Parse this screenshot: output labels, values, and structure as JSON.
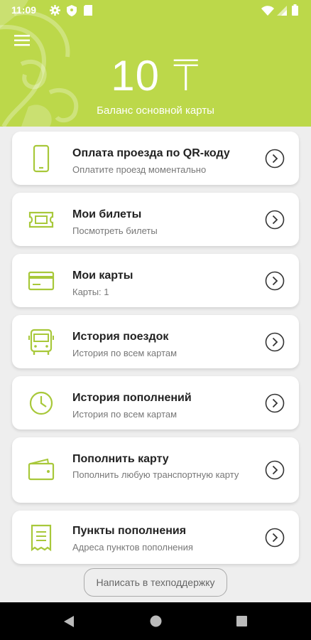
{
  "status_bar": {
    "time": "11:09"
  },
  "header": {
    "balance": "10 ₸",
    "balance_caption": "Баланс основной карты"
  },
  "menu_items": [
    {
      "title": "Оплата проезда по QR-коду",
      "subtitle": "Оплатите проезд моментально",
      "icon": "phone-icon"
    },
    {
      "title": "Мои билеты",
      "subtitle": "Посмотреть билеты",
      "icon": "ticket-icon"
    },
    {
      "title": "Мои карты",
      "subtitle": "Карты: 1",
      "icon": "card-icon"
    },
    {
      "title": "История поездок",
      "subtitle": "История по всем картам",
      "icon": "bus-icon"
    },
    {
      "title": "История пополнений",
      "subtitle": "История по всем картам",
      "icon": "clock-icon"
    },
    {
      "title": "Пополнить карту",
      "subtitle": "Пополнить любую транспортную карту",
      "icon": "wallet-icon"
    },
    {
      "title": "Пункты пополнения",
      "subtitle": "Адреса пунктов пополнения",
      "icon": "receipt-icon"
    }
  ],
  "support_button": "Написать в техподдержку",
  "colors": {
    "accent": "#bcd84a",
    "background": "#eeeeee"
  }
}
